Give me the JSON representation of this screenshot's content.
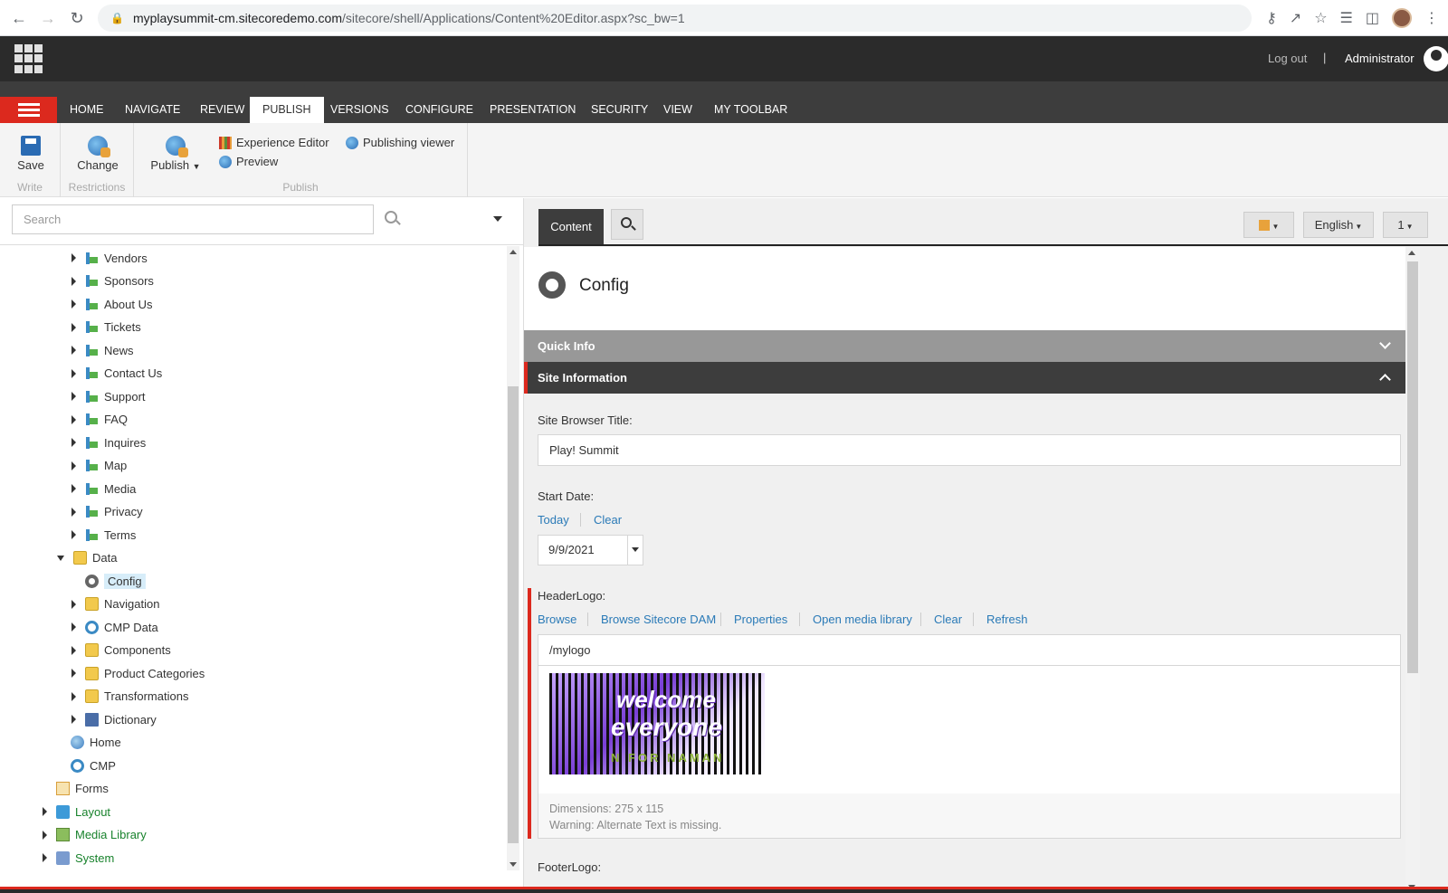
{
  "browser": {
    "url_host": "myplaysummit-cm.sitecoredemo.com",
    "url_path": "/sitecore/shell/Applications/Content%20Editor.aspx?sc_bw=1"
  },
  "topbar": {
    "logout": "Log out",
    "separator": "|",
    "user": "Administrator"
  },
  "ribbon": {
    "tabs": [
      "HOME",
      "NAVIGATE",
      "REVIEW",
      "PUBLISH",
      "VERSIONS",
      "CONFIGURE",
      "PRESENTATION",
      "SECURITY",
      "VIEW",
      "MY TOOLBAR"
    ],
    "active_tab": "PUBLISH",
    "save": "Save",
    "write_group": "Write",
    "change": "Change",
    "restrictions_group": "Restrictions",
    "publish": "Publish",
    "experience_editor": "Experience Editor",
    "preview": "Preview",
    "publishing_viewer": "Publishing viewer",
    "publish_group": "Publish"
  },
  "left": {
    "search_placeholder": "Search",
    "tree": [
      {
        "label": "Vendors",
        "icon": "page",
        "depth": 3,
        "toggle": "closed"
      },
      {
        "label": "Sponsors",
        "icon": "page",
        "depth": 3,
        "toggle": "closed"
      },
      {
        "label": "About Us",
        "icon": "page",
        "depth": 3,
        "toggle": "closed"
      },
      {
        "label": "Tickets",
        "icon": "page",
        "depth": 3,
        "toggle": "closed"
      },
      {
        "label": "News",
        "icon": "page",
        "depth": 3,
        "toggle": "closed"
      },
      {
        "label": "Contact Us",
        "icon": "page",
        "depth": 3,
        "toggle": "closed"
      },
      {
        "label": "Support",
        "icon": "page",
        "depth": 3,
        "toggle": "closed"
      },
      {
        "label": "FAQ",
        "icon": "page",
        "depth": 3,
        "toggle": "closed"
      },
      {
        "label": "Inquires",
        "icon": "page",
        "depth": 3,
        "toggle": "closed"
      },
      {
        "label": "Map",
        "icon": "page",
        "depth": 3,
        "toggle": "closed"
      },
      {
        "label": "Media",
        "icon": "page",
        "depth": 3,
        "toggle": "closed"
      },
      {
        "label": "Privacy",
        "icon": "page",
        "depth": 3,
        "toggle": "closed"
      },
      {
        "label": "Terms",
        "icon": "page",
        "depth": 3,
        "toggle": "closed"
      },
      {
        "label": "Data",
        "icon": "folder",
        "depth": 2,
        "toggle": "open"
      },
      {
        "label": "Config",
        "icon": "gear",
        "depth": 3,
        "toggle": "none",
        "selected": true
      },
      {
        "label": "Navigation",
        "icon": "folder",
        "depth": 3,
        "toggle": "closed"
      },
      {
        "label": "CMP Data",
        "icon": "cmp",
        "depth": 3,
        "toggle": "closed"
      },
      {
        "label": "Components",
        "icon": "folder",
        "depth": 3,
        "toggle": "closed"
      },
      {
        "label": "Product Categories",
        "icon": "folder",
        "depth": 3,
        "toggle": "closed"
      },
      {
        "label": "Transformations",
        "icon": "folder",
        "depth": 3,
        "toggle": "closed"
      },
      {
        "label": "Dictionary",
        "icon": "book",
        "depth": 3,
        "toggle": "closed"
      },
      {
        "label": "Home",
        "icon": "home",
        "depth": 2,
        "toggle": "none"
      },
      {
        "label": "CMP",
        "icon": "cmp",
        "depth": 2,
        "toggle": "none"
      },
      {
        "label": "Forms",
        "icon": "forms",
        "depth": 1,
        "toggle": "none"
      },
      {
        "label": "Layout",
        "icon": "layout",
        "depth": 1,
        "toggle": "closed",
        "green": true
      },
      {
        "label": "Media Library",
        "icon": "media",
        "depth": 1,
        "toggle": "closed",
        "green": true
      },
      {
        "label": "System",
        "icon": "system",
        "depth": 1,
        "toggle": "closed",
        "green": true
      }
    ]
  },
  "right": {
    "content_tab": "Content",
    "language": "English",
    "version": "1",
    "item_title": "Config",
    "sections": {
      "quick_info": "Quick Info",
      "site_information": "Site Information"
    },
    "fields": {
      "site_browser_title_label": "Site Browser Title:",
      "site_browser_title_value": "Play! Summit",
      "start_date_label": "Start Date:",
      "today": "Today",
      "clear": "Clear",
      "start_date_value": "9/9/2021",
      "header_logo_label": "HeaderLogo:",
      "logo_actions": [
        "Browse",
        "Browse Sitecore DAM",
        "Properties",
        "Open media library",
        "Clear",
        "Refresh"
      ],
      "logo_path": "/mylogo",
      "logo_text_1": "welcome",
      "logo_text_2": "everyone",
      "logo_text_3": "N FOR NAMAN",
      "dimensions": "Dimensions: 275 x 115",
      "warning": "Warning: Alternate Text is missing.",
      "footer_logo_label": "FooterLogo:"
    }
  }
}
